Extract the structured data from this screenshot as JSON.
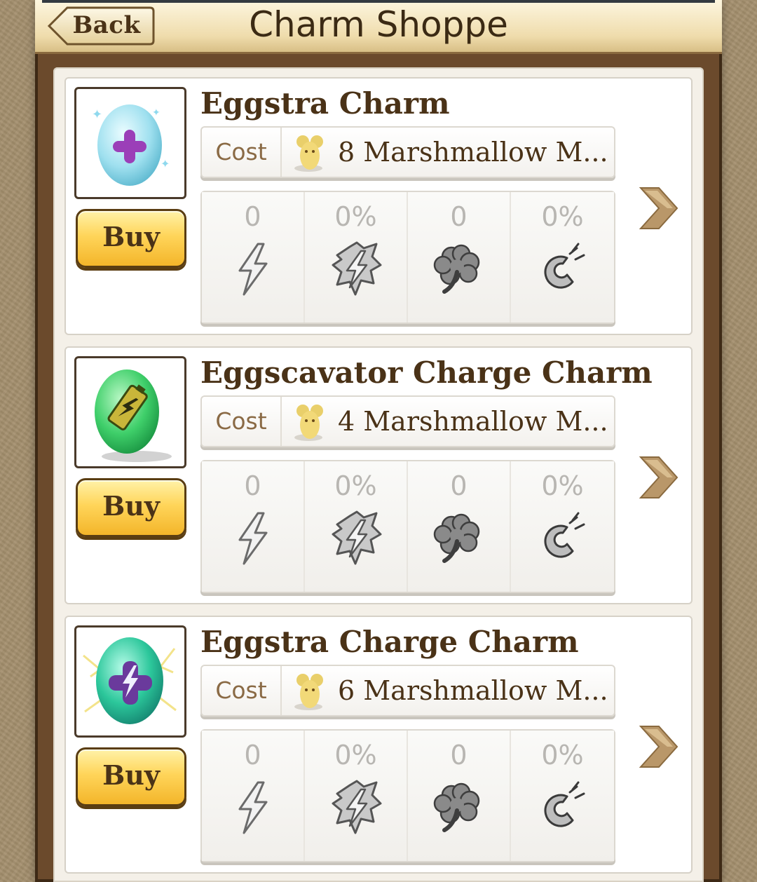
{
  "header": {
    "back_label": "Back",
    "title": "Charm Shoppe"
  },
  "labels": {
    "cost": "Cost",
    "buy": "Buy"
  },
  "charms": [
    {
      "name": "Eggstra Charm",
      "cost": "8 Marshmallow M...",
      "image": "blue-egg-plus-icon",
      "stats": [
        {
          "icon": "lightning-icon",
          "value": "0"
        },
        {
          "icon": "lightning-burst-icon",
          "value": "0%"
        },
        {
          "icon": "clover-icon",
          "value": "0"
        },
        {
          "icon": "magnet-icon",
          "value": "0%"
        }
      ]
    },
    {
      "name": "Eggscavator Charge Charm",
      "cost": "4 Marshmallow M...",
      "image": "green-egg-battery-icon",
      "stats": [
        {
          "icon": "lightning-icon",
          "value": "0"
        },
        {
          "icon": "lightning-burst-icon",
          "value": "0%"
        },
        {
          "icon": "clover-icon",
          "value": "0"
        },
        {
          "icon": "magnet-icon",
          "value": "0%"
        }
      ]
    },
    {
      "name": "Eggstra Charge Charm",
      "cost": "6 Marshmallow M...",
      "image": "teal-egg-lightning-icon",
      "stats": [
        {
          "icon": "lightning-icon",
          "value": "0"
        },
        {
          "icon": "lightning-burst-icon",
          "value": "0%"
        },
        {
          "icon": "clover-icon",
          "value": "0"
        },
        {
          "icon": "magnet-icon",
          "value": "0%"
        }
      ]
    }
  ]
}
